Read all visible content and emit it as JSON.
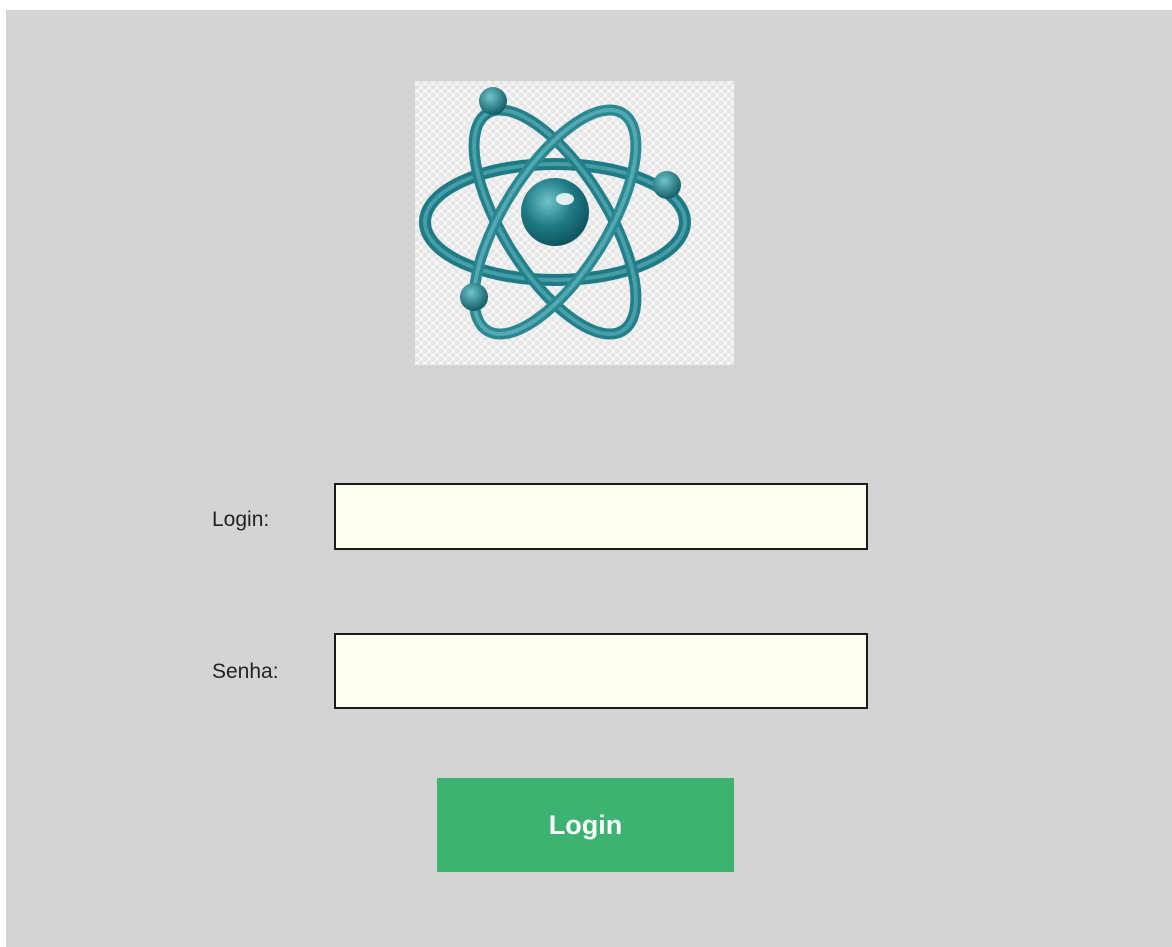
{
  "logo": {
    "icon": "atom-icon"
  },
  "form": {
    "login_label": "Login:",
    "login_value": "",
    "senha_label": "Senha:",
    "senha_value": "",
    "submit_label": "Login"
  },
  "colors": {
    "background": "#d4d4d4",
    "input_background": "#fdfff0",
    "button_background": "#3cb371",
    "button_text": "#ffffff",
    "logo_teal": "#2a8a93"
  }
}
